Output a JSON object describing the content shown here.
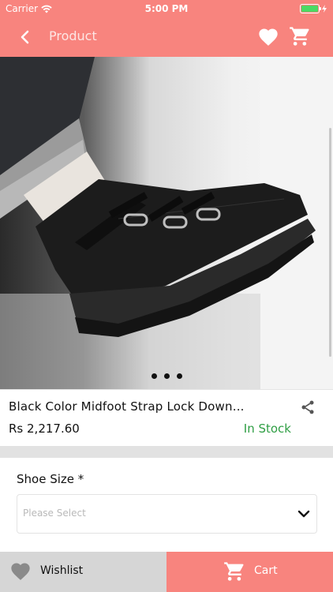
{
  "status_bar": {
    "carrier": "Carrier",
    "time": "5:00 PM"
  },
  "nav": {
    "title": "Product"
  },
  "product": {
    "name": "Black Color Midfoot Strap Lock Down...",
    "price": "Rs 2,217.60",
    "stock": "In Stock"
  },
  "carousel": {
    "page_count": 3
  },
  "options": {
    "size_label": "Shoe Size *",
    "size_placeholder": "Please Select"
  },
  "actions": {
    "wishlist_label": "Wishlist",
    "cart_label": "Cart"
  },
  "colors": {
    "accent": "#f8847e",
    "in_stock": "#2f9e44",
    "wishlist_bg": "#d6d6d6"
  }
}
